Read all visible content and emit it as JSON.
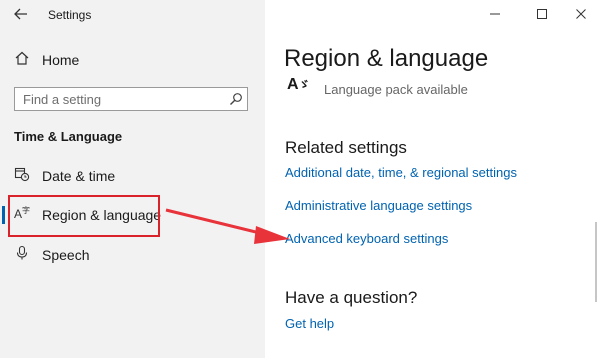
{
  "window": {
    "title": "Settings",
    "controls": {
      "minimize": "minimize-icon",
      "maximize": "maximize-icon",
      "close": "close-icon"
    }
  },
  "sidebar": {
    "home_label": "Home",
    "search": {
      "placeholder": "Find a setting",
      "value": ""
    },
    "section_header": "Time & Language",
    "items": [
      {
        "label": "Date & time",
        "icon": "calendar-clock-icon",
        "selected": false
      },
      {
        "label": "Region & language",
        "icon": "language-icon",
        "selected": true
      },
      {
        "label": "Speech",
        "icon": "microphone-icon",
        "selected": false
      }
    ]
  },
  "main": {
    "title": "Region & language",
    "language_status": "Language pack available",
    "related_header": "Related settings",
    "related_links": [
      "Additional date, time, & regional settings",
      "Administrative language settings",
      "Advanced keyboard settings"
    ],
    "question_header": "Have a question?",
    "help_link": "Get help"
  },
  "annotation": {
    "box_color": "#d9222a",
    "arrow_color": "#e8333b"
  },
  "colors": {
    "accent": "#0063b1",
    "sidebar_bg": "#f2f2f2"
  }
}
